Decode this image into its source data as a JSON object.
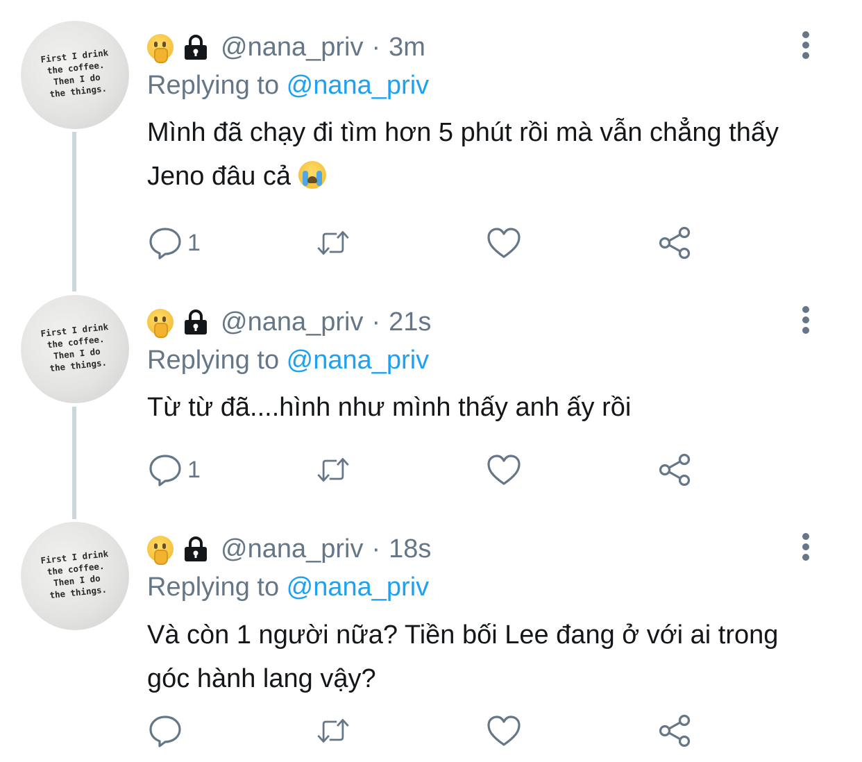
{
  "avatar_text": "First I drink\nthe coffee.\nThen I do\nthe things.",
  "replying_prefix": "Replying to",
  "tweets": [
    {
      "handle": "@nana_priv",
      "separator": "·",
      "time": "3m",
      "reply_to": "@nana_priv",
      "text": "Mình đã chạy đi tìm hơn 5 phút rồi mà vẫn chẳng thấy Jeno đâu cả",
      "trailing_emoji": "crying-face",
      "reply_count": "1"
    },
    {
      "handle": "@nana_priv",
      "separator": "·",
      "time": "21s",
      "reply_to": "@nana_priv",
      "text": "Từ từ đã....hình như mình thấy anh ấy rồi",
      "reply_count": "1"
    },
    {
      "handle": "@nana_priv",
      "separator": "·",
      "time": "18s",
      "reply_to": "@nana_priv",
      "text": "Và còn 1 người nữa? Tiền bối Lee đang ở với ai trong góc hành lang vậy?",
      "reply_count": ""
    }
  ],
  "icons": {
    "name_emoji": "shushing-face",
    "protected": "lock-icon",
    "more": "more-vertical-icon",
    "reply": "reply-bubble-icon",
    "retweet": "retweet-icon",
    "like": "heart-icon",
    "share": "share-icon"
  },
  "colors": {
    "link": "#1da1f2",
    "muted": "#657786",
    "text": "#14171a",
    "thread_line": "#ccd6dd"
  }
}
